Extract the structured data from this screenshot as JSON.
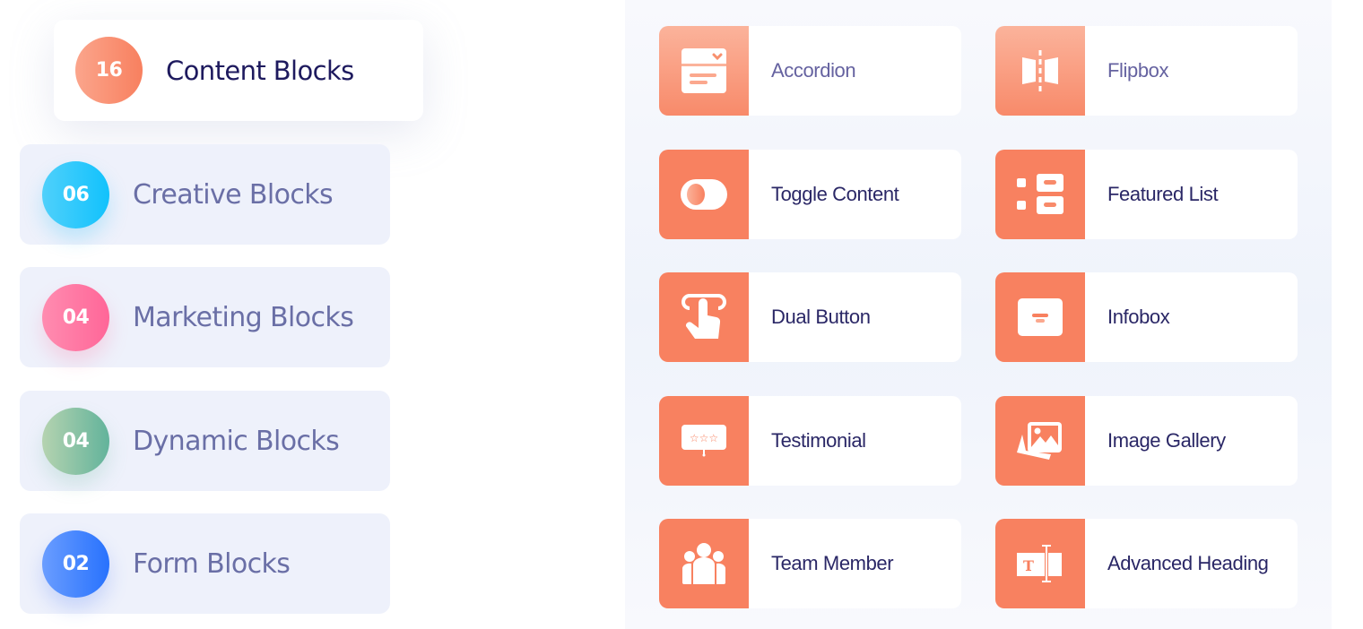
{
  "categories": [
    {
      "count": "16",
      "label": "Content Blocks",
      "active": true,
      "color_from": "#fba58c",
      "color_to": "#f8805f"
    },
    {
      "count": "06",
      "label": "Creative Blocks",
      "active": false,
      "color_from": "#4fd0fb",
      "color_to": "#12c2fc"
    },
    {
      "count": "04",
      "label": "Marketing Blocks",
      "active": false,
      "color_from": "#ff8cb0",
      "color_to": "#ff6698"
    },
    {
      "count": "04",
      "label": "Dynamic Blocks",
      "active": false,
      "color_from": "#b5d3b0",
      "color_to": "#62b39b"
    },
    {
      "count": "02",
      "label": "Form Blocks",
      "active": false,
      "color_from": "#6a9dff",
      "color_to": "#2872fd"
    }
  ],
  "widgets": [
    {
      "label": "Accordion",
      "icon": "accordion-icon"
    },
    {
      "label": "Flipbox",
      "icon": "flipbox-icon"
    },
    {
      "label": "Toggle Content",
      "icon": "toggle-icon"
    },
    {
      "label": "Featured List",
      "icon": "featured-list-icon"
    },
    {
      "label": "Dual Button",
      "icon": "dual-button-icon"
    },
    {
      "label": "Infobox",
      "icon": "infobox-icon"
    },
    {
      "label": "Testimonial",
      "icon": "testimonial-icon"
    },
    {
      "label": "Image Gallery",
      "icon": "image-gallery-icon"
    },
    {
      "label": "Team Member",
      "icon": "team-member-icon"
    },
    {
      "label": "Advanced Heading",
      "icon": "advanced-heading-icon"
    }
  ],
  "colors": {
    "accent": "#f88160",
    "active_label": "#1e1a5e",
    "inactive_label": "#6a6fa6",
    "widget_label": "#2a2766"
  }
}
